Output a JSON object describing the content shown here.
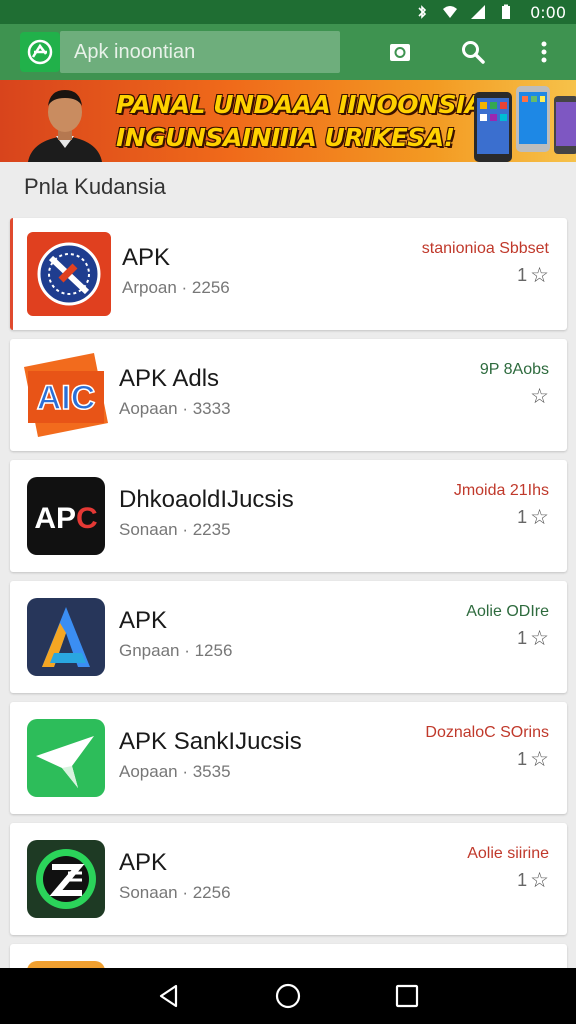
{
  "status_bar": {
    "time": "0:00",
    "icons": [
      "bluetooth-icon",
      "wifi-icon",
      "signal-icon",
      "battery-icon"
    ]
  },
  "app_bar": {
    "search_placeholder": "Apk inoontian",
    "icons": [
      "app-logo-icon",
      "camera-icon",
      "search-icon",
      "more-vert-icon"
    ],
    "color": "#3e9350"
  },
  "banner": {
    "line1": "PANAL UNDAAA IINOONSIA",
    "line2": "INGUNSAINIIIA URIKESA!"
  },
  "section_title": "Pnla Kudansia",
  "apps": [
    {
      "name": "APK",
      "meta": "Arpoan · 2256",
      "tag": "stanionioa Sbbset",
      "tag_color": "#c0392b",
      "rating": "1",
      "icon": "apk-red-circle-icon"
    },
    {
      "name": "APK Adls",
      "meta": "Aopaan · 3333",
      "tag": "9P 8Aobs",
      "tag_color": "#2e6b3e",
      "rating": "",
      "icon": "aic-orange-icon"
    },
    {
      "name": "DhkoaoldIJucsis",
      "meta": "Sonaan · 2235",
      "tag": "Jmoida 21Ihs",
      "tag_color": "#c0392b",
      "rating": "1",
      "icon": "apc-black-icon"
    },
    {
      "name": "APK",
      "meta": "Gnpaan · 1256",
      "tag": "Aolie ODIre",
      "tag_color": "#2e6b3e",
      "rating": "1",
      "icon": "blue-a-icon"
    },
    {
      "name": "APK SankIJucsis",
      "meta": "Aopaan · 3535",
      "tag": "DoznaloC SOrins",
      "tag_color": "#c0392b",
      "rating": "1",
      "icon": "green-star-icon"
    },
    {
      "name": "APK",
      "meta": "Sonaan · 2256",
      "tag": "Aolie siirine",
      "tag_color": "#c0392b",
      "rating": "1",
      "icon": "green-z-icon"
    }
  ],
  "nav_bar": {
    "icons": [
      "back-icon",
      "home-icon",
      "recents-icon"
    ]
  }
}
